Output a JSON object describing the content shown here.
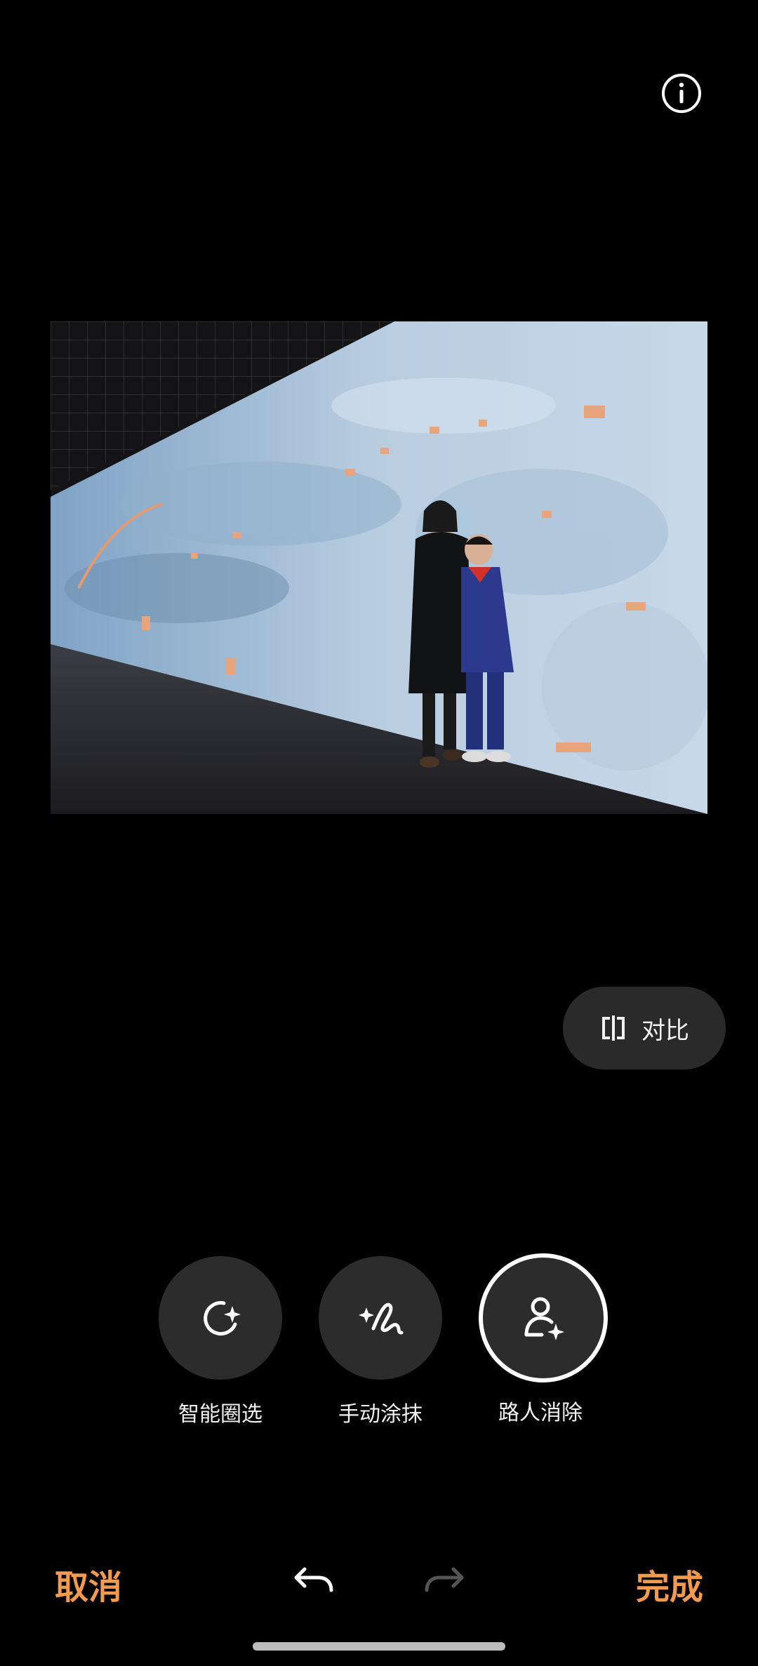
{
  "top": {
    "info_icon": "info-circle-icon"
  },
  "photo": {
    "description_icon": "photo"
  },
  "compare": {
    "label": "对比",
    "icon": "compare-split-icon"
  },
  "tools": [
    {
      "label": "智能圈选",
      "icon": "lasso-sparkle-icon"
    },
    {
      "label": "手动涂抹",
      "icon": "brush-sparkle-icon"
    },
    {
      "label": "路人消除",
      "icon": "person-sparkle-icon",
      "active": true
    }
  ],
  "bottom": {
    "cancel_label": "取消",
    "done_label": "完成",
    "undo_icon": "undo-icon",
    "redo_icon": "redo-icon"
  },
  "colors": {
    "accent": "#f29a4d",
    "background": "#000000",
    "button": "#2c2c2c"
  }
}
